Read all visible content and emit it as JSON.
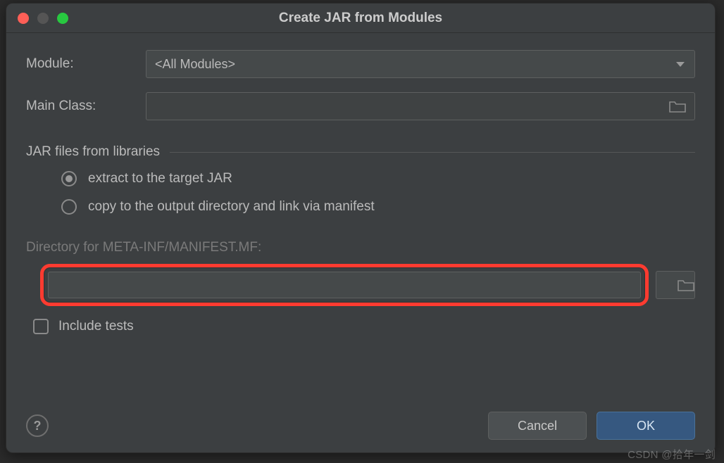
{
  "title": "Create JAR from Modules",
  "labels": {
    "module": "Module:",
    "main_class": "Main Class:",
    "section": "JAR files from libraries",
    "directory": "Directory for META-INF/MANIFEST.MF:",
    "include_tests": "Include tests"
  },
  "module_select": {
    "value": "<All Modules>"
  },
  "main_class_value": "",
  "radios": {
    "extract": "extract to the target JAR",
    "copy": "copy to the output directory and link via manifest",
    "selected": "extract"
  },
  "directory_value": "",
  "buttons": {
    "cancel": "Cancel",
    "ok": "OK",
    "help": "?"
  },
  "watermark": "CSDN @拾年一剑"
}
